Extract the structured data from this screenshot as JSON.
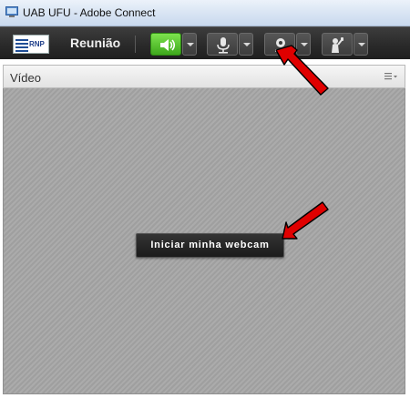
{
  "window": {
    "title": "UAB UFU - Adobe Connect"
  },
  "menubar": {
    "logo_text": "RNP",
    "menu_label": "Reunião",
    "controls": [
      {
        "icon": "speaker-icon",
        "state": "on",
        "color": "#4cc22a"
      },
      {
        "icon": "microphone-icon"
      },
      {
        "icon": "webcam-icon"
      },
      {
        "icon": "raise-hand-icon"
      }
    ]
  },
  "pod": {
    "title": "Vídeo",
    "menu_icon": "pod-options-icon",
    "start_webcam_label": "Iniciar minha webcam"
  },
  "annotations": {
    "arrow_color": "#e00000",
    "arrows": [
      "arrow-to-webcam-button",
      "arrow-to-start-webcam"
    ]
  }
}
